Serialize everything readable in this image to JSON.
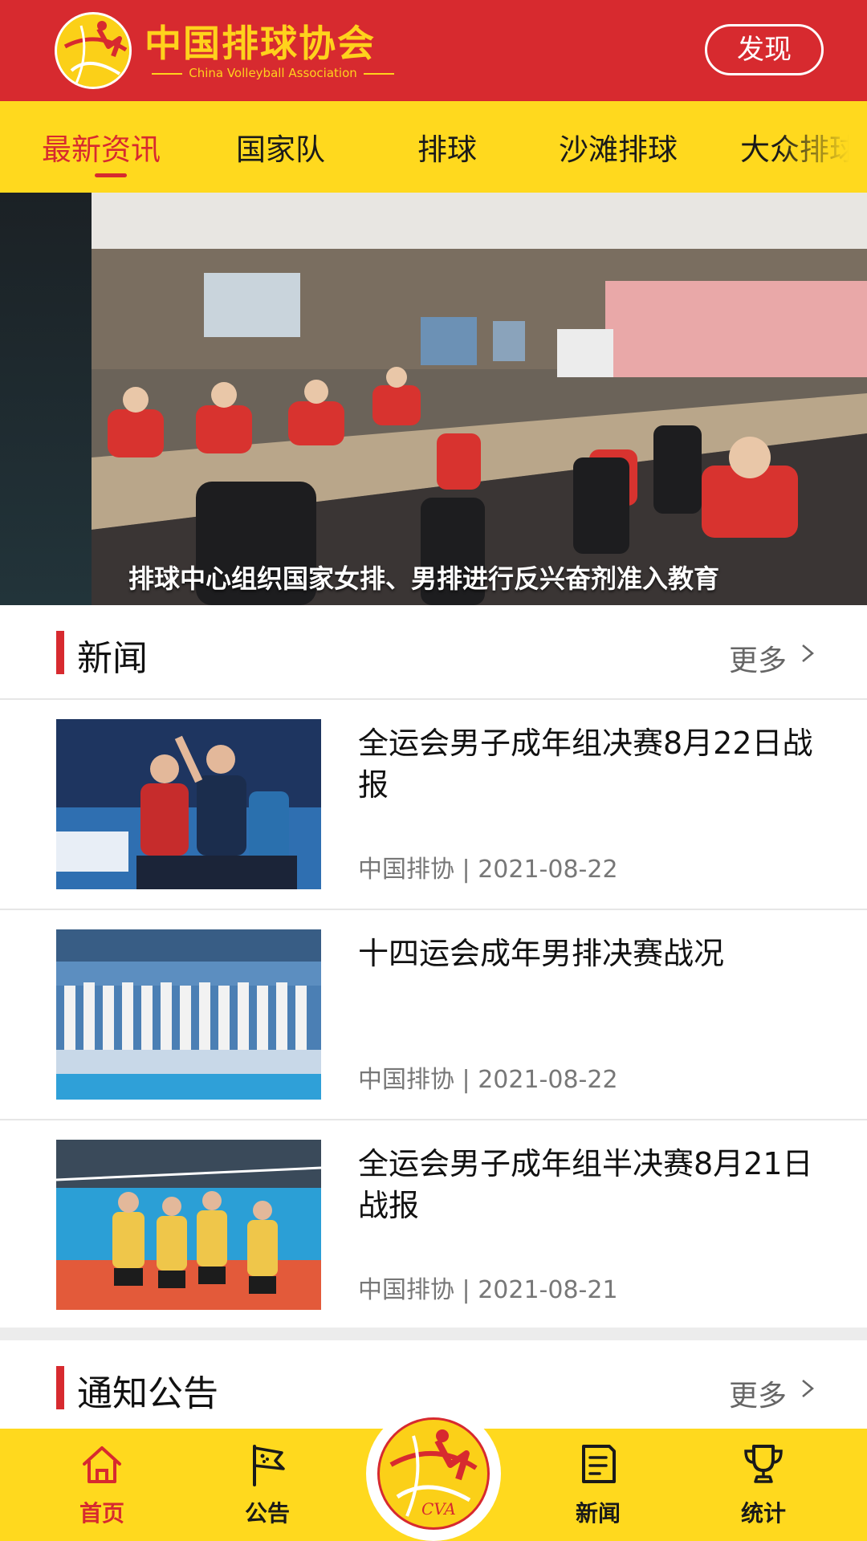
{
  "header": {
    "brand_cn": "中国排球协会",
    "brand_en": "China Volleyball Association",
    "discover_label": "发现"
  },
  "tabs": [
    {
      "label": "最新资讯",
      "active": true
    },
    {
      "label": "国家队",
      "active": false
    },
    {
      "label": "排球",
      "active": false
    },
    {
      "label": "沙滩排球",
      "active": false
    },
    {
      "label": "大众排球",
      "active": false
    }
  ],
  "banner": {
    "caption": "排球中心组织国家女排、男排进行反兴奋剂准入教育",
    "dots_count": 5,
    "active_dot": 3
  },
  "news_section": {
    "title": "新闻",
    "more_label": "更多",
    "items": [
      {
        "title": "全运会男子成年组决赛8月22日战报",
        "source": "中国排协",
        "date": "2021-08-22"
      },
      {
        "title": "十四运会成年男排决赛战况",
        "source": "中国排协",
        "date": "2021-08-22"
      },
      {
        "title": "全运会男子成年组半决赛8月21日战报",
        "source": "中国排协",
        "date": "2021-08-21"
      }
    ]
  },
  "notice_section": {
    "title": "通知公告",
    "more_label": "更多"
  },
  "bottom_nav": [
    {
      "label": "首页",
      "icon": "home-icon",
      "active": true
    },
    {
      "label": "公告",
      "icon": "flag-icon",
      "active": false
    },
    {
      "label": "",
      "icon": "cva-emblem-icon",
      "active": false
    },
    {
      "label": "新闻",
      "icon": "news-icon",
      "active": false
    },
    {
      "label": "统计",
      "icon": "trophy-icon",
      "active": false
    }
  ],
  "colors": {
    "brand_red": "#d72a2f",
    "brand_yellow": "#ffd91e"
  }
}
